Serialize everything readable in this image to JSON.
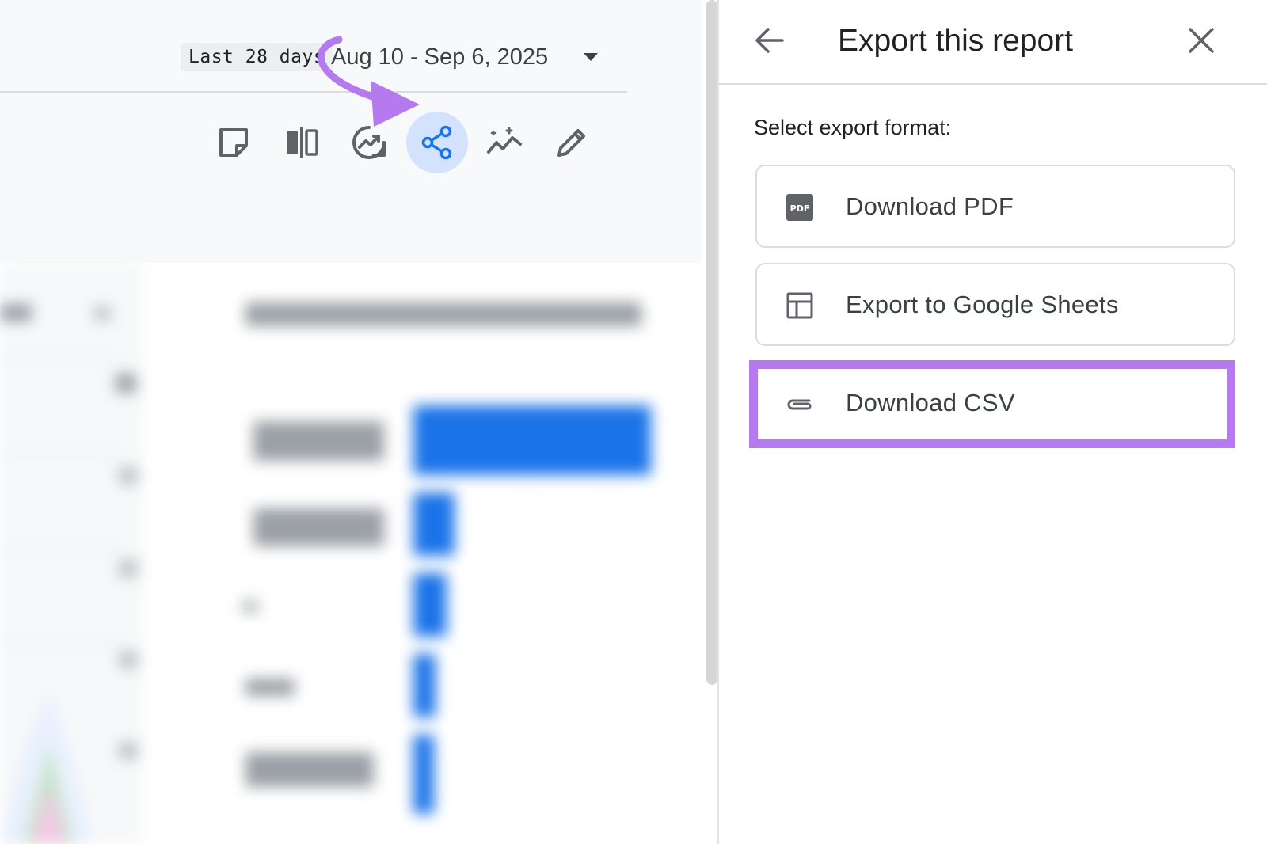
{
  "header": {
    "date_preset": "Last 28 days",
    "date_range": "Aug 10 - Sep 6, 2025"
  },
  "toolbar": {
    "icons": [
      "note-icon",
      "compare-icon",
      "insights-icon",
      "share-icon",
      "sparkle-trend-icon",
      "pencil-icon"
    ],
    "active_icon": "share-icon"
  },
  "export_panel": {
    "title": "Export this report",
    "format_label": "Select export format:",
    "options": [
      {
        "label": "Download PDF",
        "icon": "pdf-icon"
      },
      {
        "label": "Export to Google Sheets",
        "icon": "table-icon"
      },
      {
        "label": "Download CSV",
        "icon": "paperclip-icon"
      }
    ],
    "highlighted_option": "Download CSV"
  },
  "colors": {
    "accent_blue": "#1a73e8",
    "active_bg": "#d3e3fd",
    "highlight_purple": "#b57bee",
    "icon_gray": "#5f6368"
  }
}
